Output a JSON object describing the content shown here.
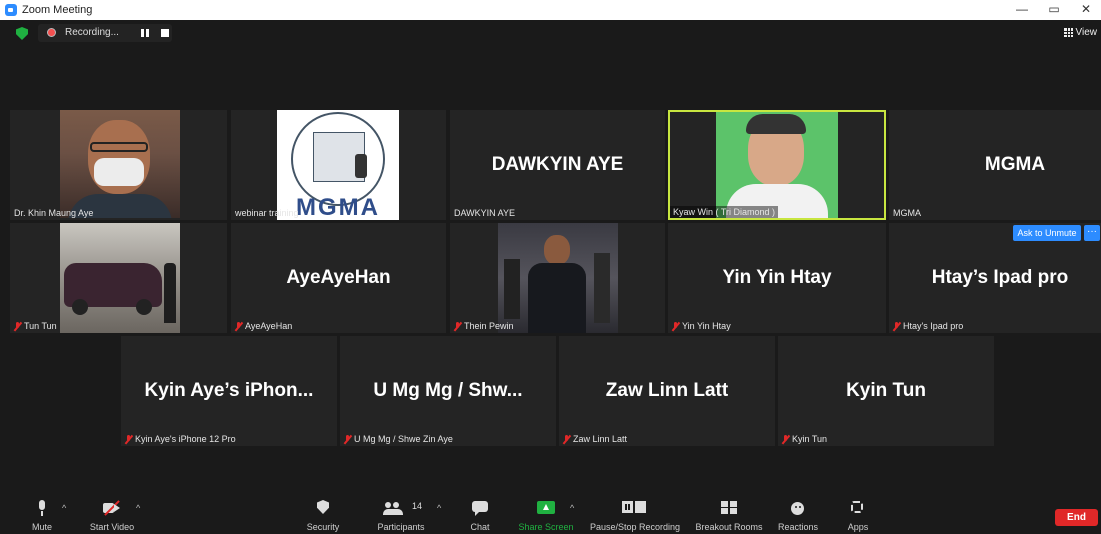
{
  "window": {
    "title": "Zoom Meeting",
    "controls": {
      "minimize": "—",
      "maximize": "▭",
      "close": "✕"
    }
  },
  "topbar": {
    "recording_text": "Recording...",
    "view_label": "View"
  },
  "tiles": [
    {
      "name": "Dr. Khin Maung Aye",
      "display": "",
      "muted": false
    },
    {
      "name": "webinar training",
      "display": "",
      "muted": false
    },
    {
      "name": "DAWKYIN AYE",
      "display": "DAWKYIN AYE",
      "muted": false
    },
    {
      "name": "Kyaw Win ( Tri Diamond )",
      "display": "",
      "muted": false,
      "active": true
    },
    {
      "name": "MGMA",
      "display": "MGMA",
      "muted": false
    },
    {
      "name": "Tun Tun",
      "display": "",
      "muted": true
    },
    {
      "name": "AyeAyeHan",
      "display": "AyeAyeHan",
      "muted": true
    },
    {
      "name": "Thein Pewin",
      "display": "",
      "muted": true
    },
    {
      "name": "Yin Yin Htay",
      "display": "Yin Yin Htay",
      "muted": true
    },
    {
      "name": "Htay's Ipad pro",
      "display": "Htay’s Ipad pro",
      "muted": true
    },
    {
      "name": "Kyin Aye's iPhone 12 Pro",
      "display": "Kyin Aye’s iPhon...",
      "muted": true
    },
    {
      "name": "U Mg Mg / Shwe Zin Aye",
      "display": "U Mg Mg / Shw...",
      "muted": true
    },
    {
      "name": "Zaw Linn Latt",
      "display": "Zaw Linn Latt",
      "muted": true
    },
    {
      "name": "Kyin Tun",
      "display": "Kyin Tun",
      "muted": true
    }
  ],
  "logo_text": "MGMA",
  "hover_controls": {
    "ask_to_unmute": "Ask to Unmute",
    "more": "···"
  },
  "toolbar": {
    "mute": "Mute",
    "start_video": "Start Video",
    "security": "Security",
    "participants": "Participants",
    "participants_count": "14",
    "chat": "Chat",
    "share_screen": "Share Screen",
    "pause_stop_recording": "Pause/Stop Recording",
    "breakout_rooms": "Breakout Rooms",
    "reactions": "Reactions",
    "apps": "Apps",
    "end": "End",
    "caret": "^"
  },
  "colors": {
    "active_speaker_border": "#c8e640",
    "share_screen_green": "#20b141",
    "end_red": "#e02828",
    "accent_blue": "#2d8cff"
  }
}
